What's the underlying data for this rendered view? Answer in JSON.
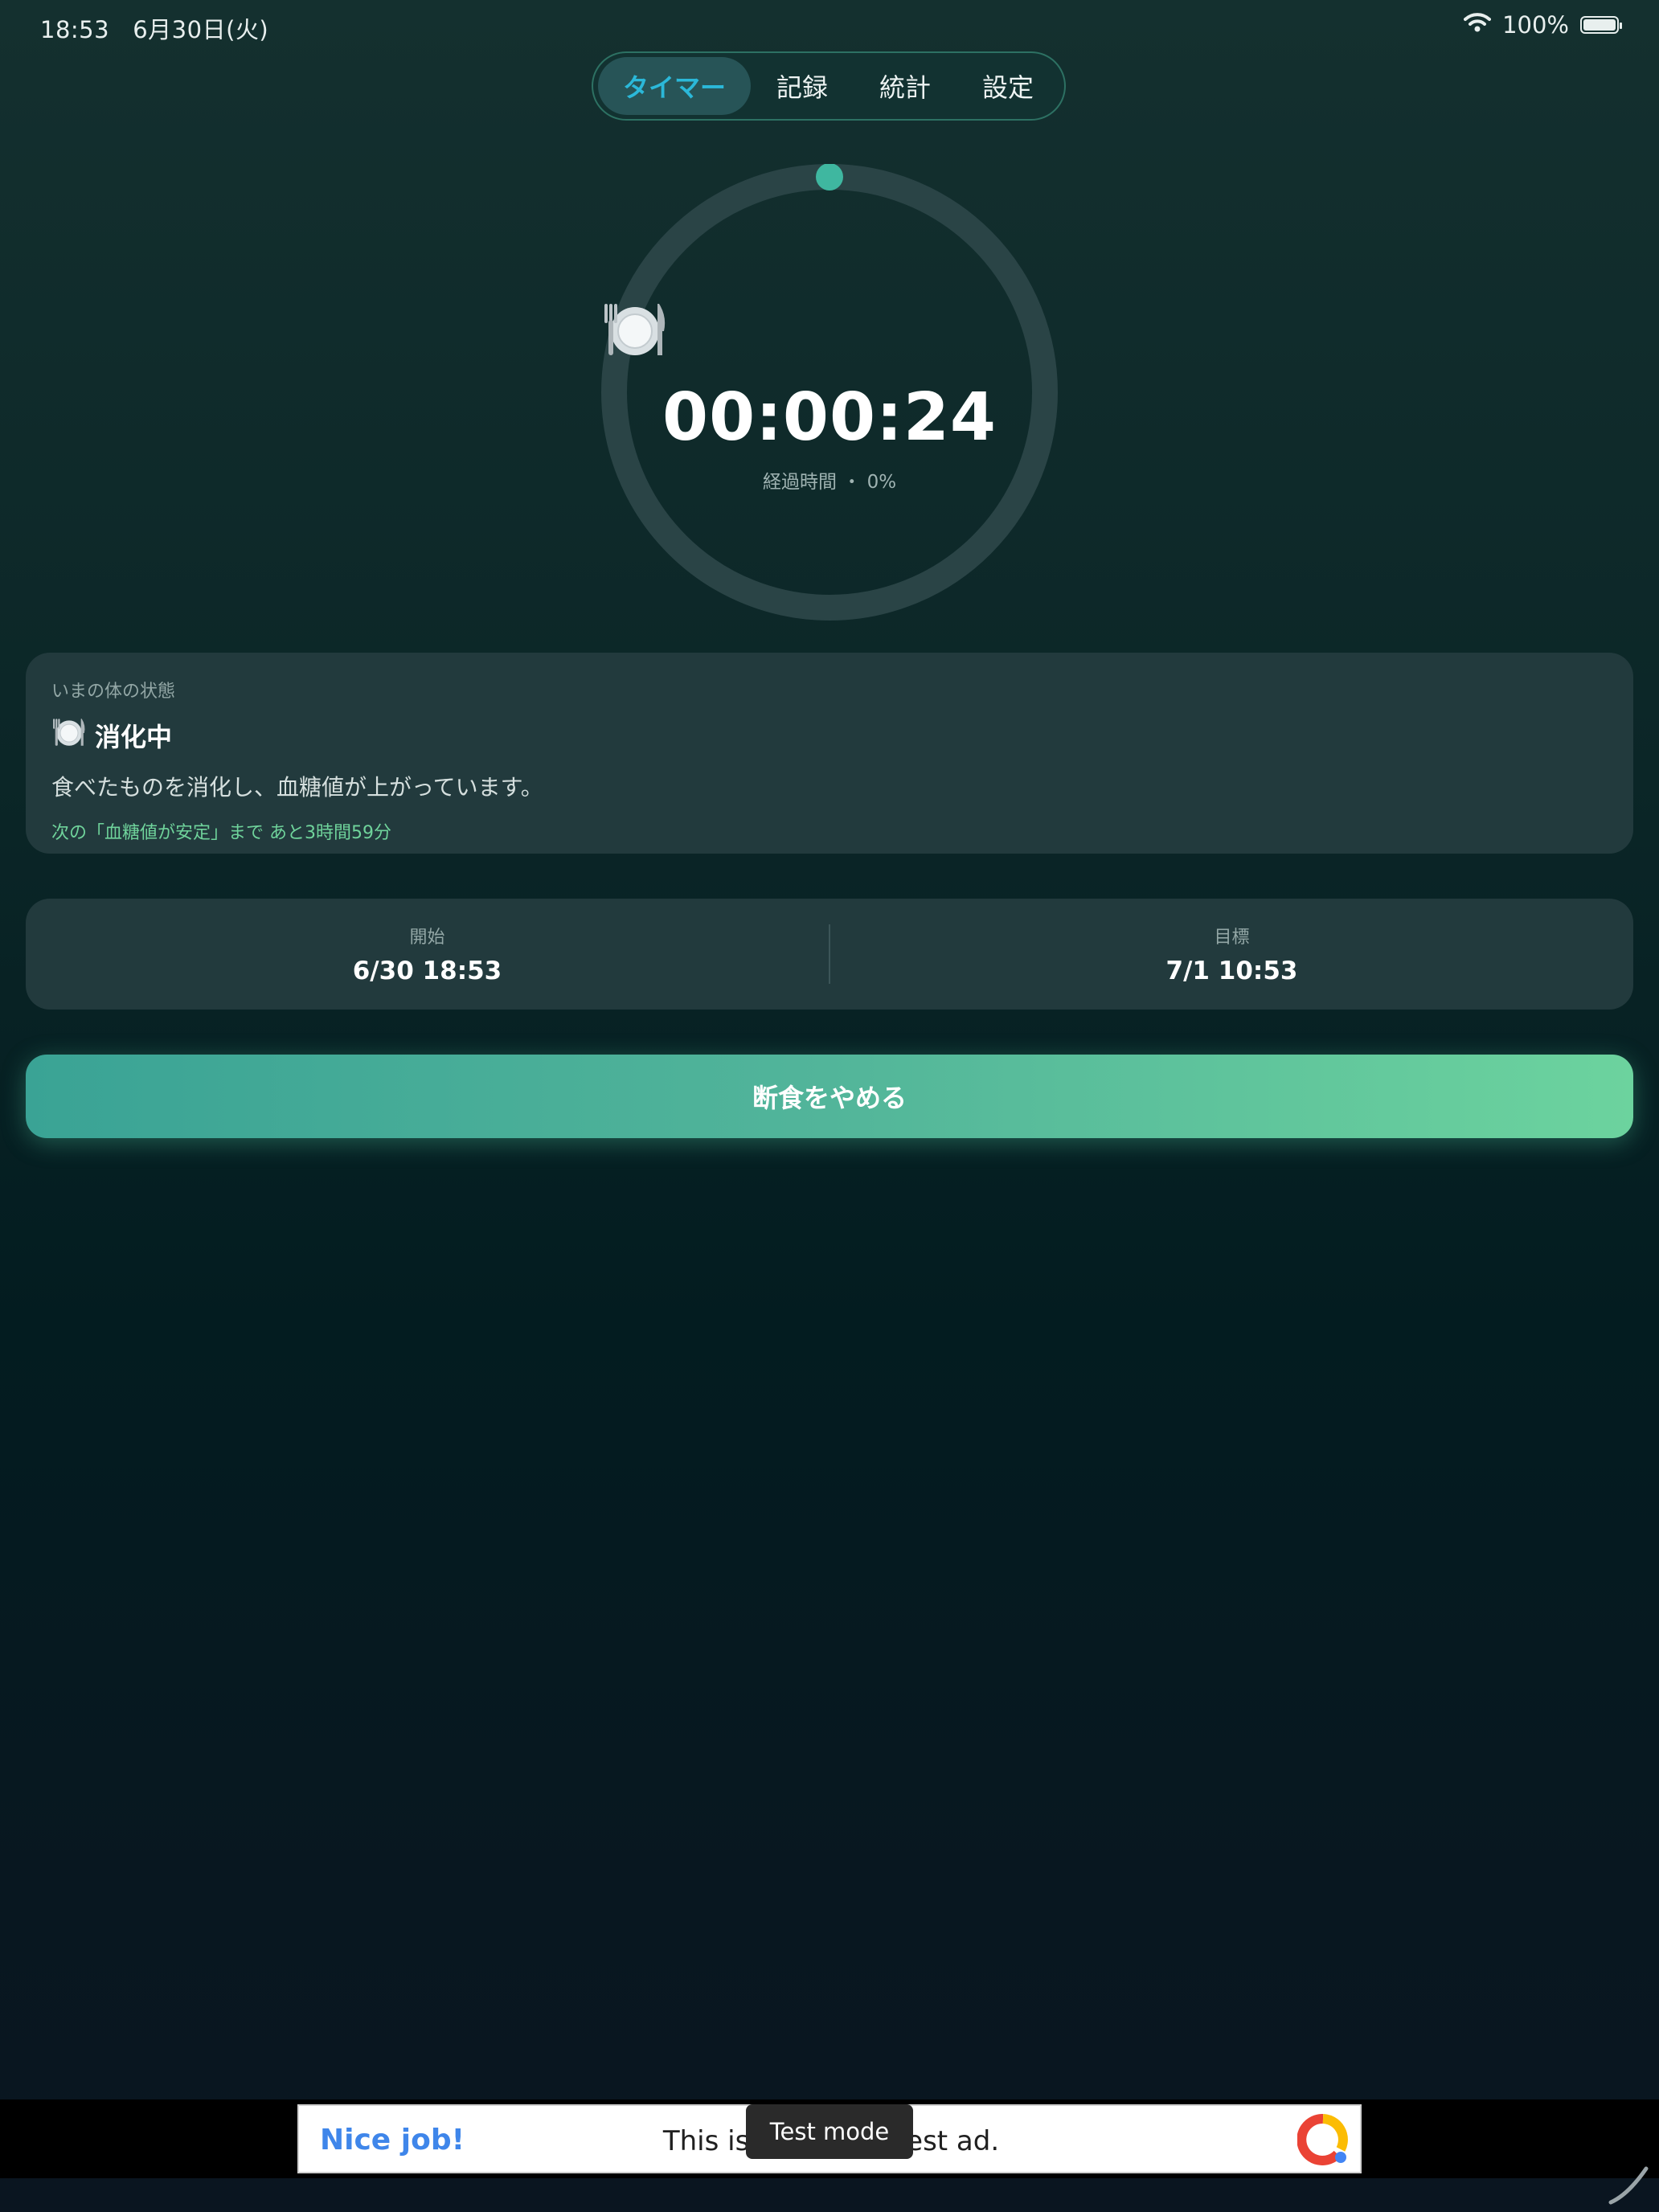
{
  "status_bar": {
    "time": "18:53",
    "date": "6月30日(火)",
    "battery": "100%",
    "wifi_icon": "wifi-icon",
    "battery_icon": "battery-icon"
  },
  "tabs": [
    {
      "label": "タイマー",
      "active": true
    },
    {
      "label": "記録",
      "active": false
    },
    {
      "label": "統計",
      "active": false
    },
    {
      "label": "設定",
      "active": false
    }
  ],
  "timer": {
    "icon": "fork-knife-plate-icon",
    "elapsed": "00:00:24",
    "sub_label": "経過時間",
    "separator": "・",
    "percent": "0%",
    "progress": 0,
    "accent": "#3fb7a0"
  },
  "state": {
    "heading": "いまの体の状態",
    "icon": "fork-knife-plate-icon",
    "title": "消化中",
    "description": "食べたものを消化し、血糖値が上がっています。",
    "next": "次の「血糖値が安定」まで あと3時間59分",
    "next_color": "#6fd39b"
  },
  "times": {
    "start_label": "開始",
    "start_value": "6/30 18:53",
    "goal_label": "目標",
    "goal_value": "7/1 10:53"
  },
  "stop_button": {
    "label": "断食をやめる"
  },
  "ad": {
    "nice": "Nice job!",
    "text": "This is a 320x32 test ad.",
    "test_mode": "Test mode"
  },
  "colors": {
    "tab_active_text": "#2bb8d9",
    "card_bg": "#223a3d",
    "button_start": "#3aa395",
    "button_end": "#6cd39e"
  }
}
